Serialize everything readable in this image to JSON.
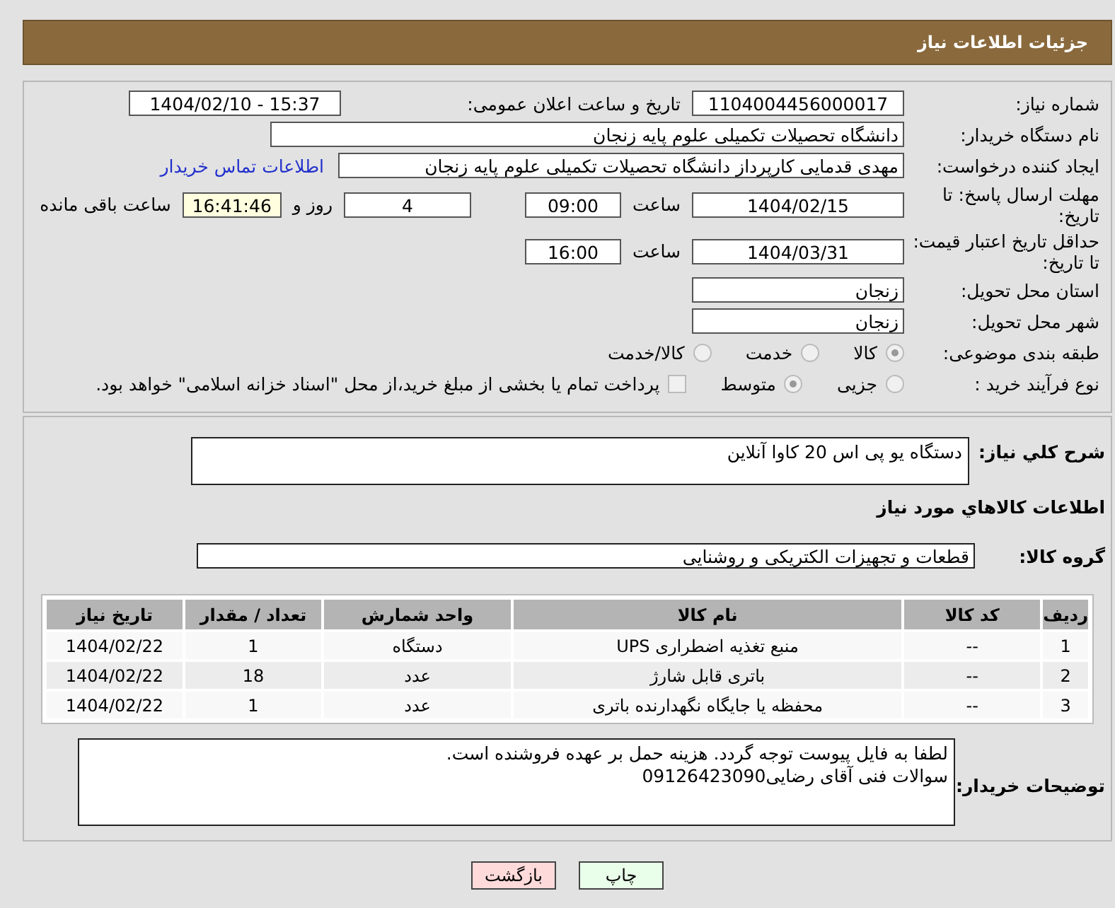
{
  "header": {
    "title": "جزئیات اطلاعات نیاز"
  },
  "need_number": {
    "label": "شماره نیاز:",
    "value": "1104004456000017"
  },
  "announce": {
    "label": "تاریخ و ساعت اعلان عمومی:",
    "value": "1404/02/10 - 15:37"
  },
  "buyer": {
    "label": "نام دستگاه خریدار:",
    "value": "دانشگاه تحصیلات تکمیلی علوم پایه زنجان"
  },
  "requester": {
    "label": "ایجاد کننده درخواست:",
    "value": "مهدی قدمایی کارپرداز دانشگاه تحصیلات تکمیلی علوم پایه زنجان",
    "link": "اطلاعات تماس خریدار"
  },
  "deadline": {
    "label": "مهلت ارسال پاسخ: تا تاریخ:",
    "date": "1404/02/15",
    "time_label": "ساعت",
    "time": "09:00",
    "days": "4",
    "days_label": "روز و",
    "remaining": "16:41:46",
    "remaining_label": "ساعت باقی مانده"
  },
  "validity": {
    "label": "حداقل تاریخ اعتبار قیمت: تا تاریخ:",
    "date": "1404/03/31",
    "time_label": "ساعت",
    "time": "16:00"
  },
  "province": {
    "label": "استان محل تحویل:",
    "value": "زنجان"
  },
  "city": {
    "label": "شهر محل تحویل:",
    "value": "زنجان"
  },
  "category": {
    "label": "طبقه بندی موضوعی:",
    "options": [
      {
        "label": "کالا",
        "selected": true
      },
      {
        "label": "خدمت",
        "selected": false
      },
      {
        "label": "کالا/خدمت",
        "selected": false
      }
    ]
  },
  "process": {
    "label": "نوع فرآیند خرید :",
    "options": [
      {
        "label": "جزیی",
        "selected": false
      },
      {
        "label": "متوسط",
        "selected": true
      }
    ],
    "checkbox": {
      "label": "پرداخت تمام یا بخشی از مبلغ خرید،از محل \"اسناد خزانه اسلامی\" خواهد بود.",
      "checked": false
    }
  },
  "description": {
    "label": "شرح کلي نياز:",
    "value": "دستگاه یو پی اس 20 کاوا آنلاین"
  },
  "goods_heading": "اطلاعات کالاهاي مورد نياز",
  "group": {
    "label": "گروه کالا:",
    "value": "قطعات و تجهیزات الکتریکی و روشنایی"
  },
  "table": {
    "columns": [
      "رديف",
      "کد کالا",
      "نام کالا",
      "واحد شمارش",
      "تعداد / مقدار",
      "تاریخ نیاز"
    ],
    "rows": [
      [
        "1",
        "--",
        "منبع تغذیه اضطراری UPS",
        "دستگاه",
        "1",
        "1404/02/22"
      ],
      [
        "2",
        "--",
        "باتری قابل شارژ",
        "عدد",
        "18",
        "1404/02/22"
      ],
      [
        "3",
        "--",
        "محفظه یا جایگاه نگهدارنده باتری",
        "عدد",
        "1",
        "1404/02/22"
      ]
    ]
  },
  "notes": {
    "label": "توضیحات خریدار:",
    "lines": [
      "لطفا به فایل پیوست توجه گردد. هزینه حمل بر عهده فروشنده است.",
      "سوالات فنی آقای رضایی09126423090"
    ]
  },
  "buttons": [
    {
      "label": "چاپ",
      "kind": "print"
    },
    {
      "label": "بازگشت",
      "kind": "back"
    }
  ]
}
